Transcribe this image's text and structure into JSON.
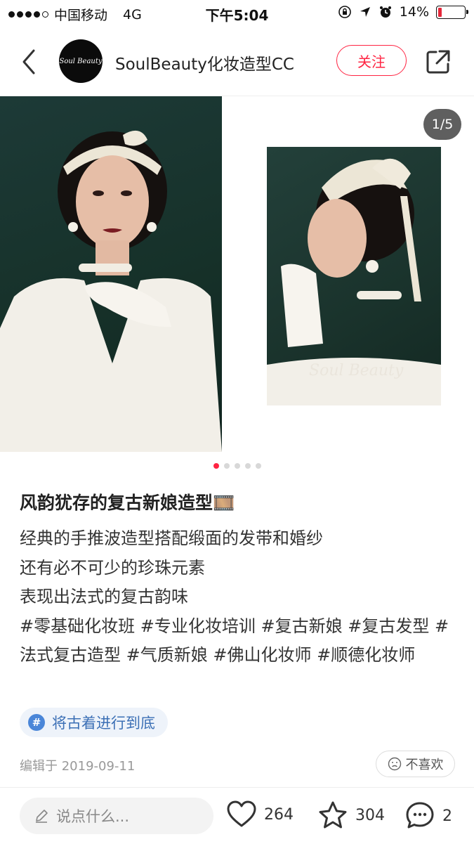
{
  "status_bar": {
    "carrier": "中国移动",
    "network": "4G",
    "time": "下午5:04",
    "battery": "14%"
  },
  "header": {
    "author_name": "SoulBeauty化妆造型CC",
    "avatar_text": "Soul Beauty",
    "follow_label": "关注"
  },
  "carousel": {
    "page_indicator": "1/5",
    "total_dots": 5,
    "active_dot": 1
  },
  "post": {
    "title": "风韵犹存的复古新娘造型🎞️",
    "lines": [
      "经典的手推波造型搭配缎面的发带和婚纱",
      "还有必不可少的珍珠元素",
      "表现出法式的复古韵味"
    ],
    "hashtags": "#零基础化妆班 #专业化妆培训 #复古新娘 #复古发型 #法式复古造型 #气质新娘 #佛山化妆师 #顺德化妆师",
    "topic": "将古着进行到底",
    "edit_date": "编辑于 2019-09-11",
    "dislike_label": "不喜欢"
  },
  "bottom_bar": {
    "comment_placeholder": "说点什么...",
    "likes": "264",
    "stars": "304",
    "comments": "2"
  },
  "colors": {
    "accent": "#ff2442",
    "topic": "#3b6fb5",
    "topic_bg": "#eef3fa"
  },
  "icons": {
    "back": "chevron-left-icon",
    "share": "share-icon",
    "topic": "hash-icon",
    "dislike": "frown-icon",
    "comment_input": "pencil-icon",
    "like": "heart-icon",
    "star": "star-icon",
    "comment": "chat-bubble-icon"
  }
}
